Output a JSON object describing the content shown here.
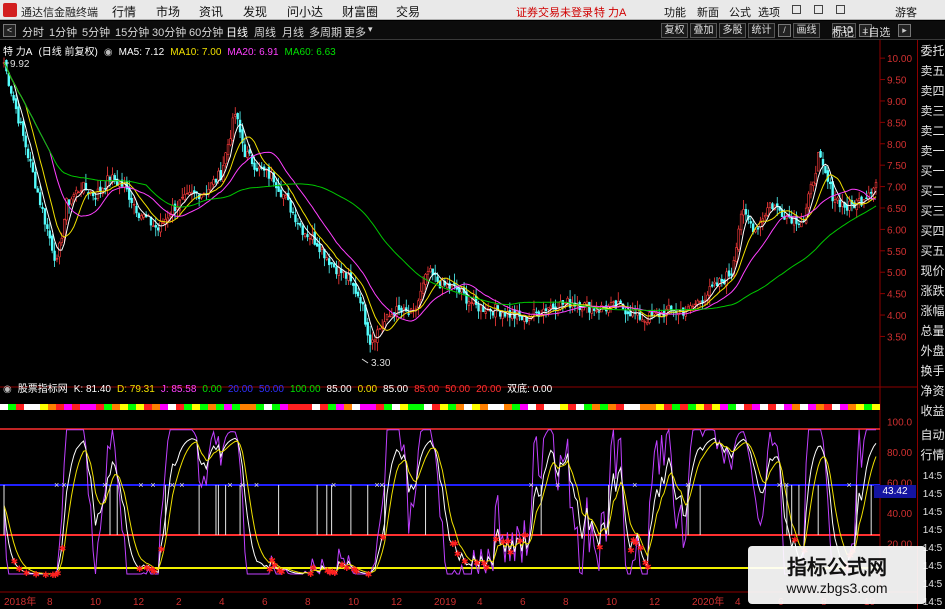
{
  "app": {
    "title": "通达信金融终端",
    "menu": [
      "行情",
      "市场",
      "资讯",
      "发现",
      "问小达",
      "财富圈",
      "交易"
    ],
    "status_text": "证券交易未登录",
    "stock_name": "特 力A",
    "right_menu": [
      "功能",
      "新面",
      "公式",
      "选项"
    ],
    "guest": "游客"
  },
  "periods": [
    "分时",
    "1分钟",
    "5分钟",
    "15分钟",
    "30分钟",
    "60分钟",
    "日线",
    "周线",
    "月线",
    "多周期",
    "更多"
  ],
  "active_period": "日线",
  "toolbar_right": [
    "复权",
    "叠加",
    "多股",
    "统计",
    "画线",
    "F10",
    "标记",
    "+自选"
  ],
  "main_legend": {
    "name": "特 力A",
    "mode": "(日线 前复权)",
    "ma5": "MA5: 7.12",
    "ma10": "MA10: 7.00",
    "ma20": "MA20: 6.91",
    "ma60": "MA60: 6.63",
    "colors": {
      "ma5": "#ffffff",
      "ma10": "#f0e000",
      "ma20": "#ff40ff",
      "ma60": "#00e000"
    }
  },
  "price_axis": [
    "10.00",
    "9.50",
    "9.00",
    "8.50",
    "8.00",
    "7.50",
    "7.00",
    "6.50",
    "6.00",
    "5.50",
    "5.00",
    "4.50",
    "4.00",
    "3.50"
  ],
  "annotations": {
    "high": "9.92",
    "low": "3.30"
  },
  "indicator_legend": {
    "name": "股票指标网",
    "k": "K: 81.40",
    "d": "D: 79.31",
    "j": "J: 85.58",
    "vals": [
      "0.00",
      "20.00",
      "50.00",
      "100.00",
      "85.00",
      "0.00",
      "85.00",
      "85.00",
      "50.00",
      "20.00"
    ],
    "last": "双底: 0.00"
  },
  "indicator_axis": [
    "100.0",
    "80.00",
    "60.00",
    "40.00",
    "20.00"
  ],
  "indicator_current": "43.42",
  "x_axis": [
    "2018年",
    "8",
    "10",
    "12",
    "2",
    "4",
    "6",
    "8",
    "10",
    "12",
    "2019",
    "4",
    "6",
    "8",
    "10",
    "12",
    "2020年",
    "4",
    "6",
    "8",
    "10"
  ],
  "side_panel": [
    "委托",
    "卖五",
    "卖四",
    "卖三",
    "卖二",
    "卖一",
    "买一",
    "买二",
    "买三",
    "买四",
    "买五",
    "现价",
    "涨跌",
    "涨幅",
    "总量",
    "外盘",
    "换手",
    "净资",
    "收益",
    "自动",
    "行情",
    "14:5",
    "14:5",
    "14:5",
    "14:5",
    "14:5",
    "14:5",
    "14:5",
    "14:5",
    "14:5"
  ],
  "watermark": {
    "line1": "指标公式网",
    "line2": "www.zbgs3.com"
  }
}
